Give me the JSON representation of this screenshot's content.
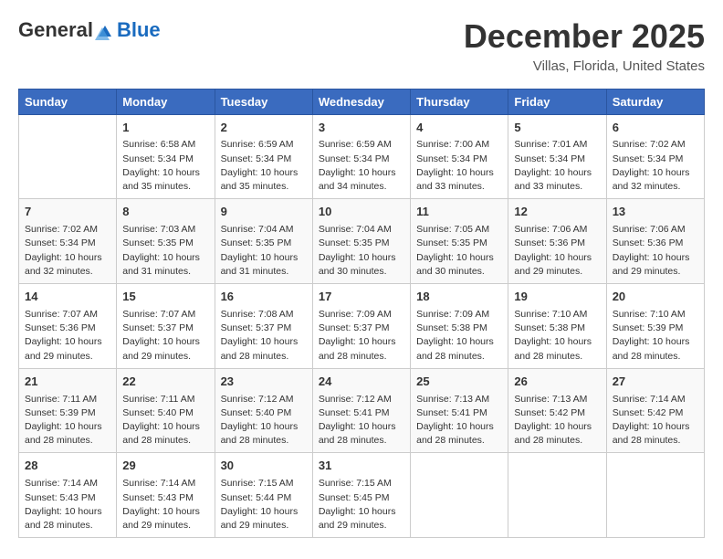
{
  "header": {
    "logo_general": "General",
    "logo_blue": "Blue",
    "month": "December 2025",
    "location": "Villas, Florida, United States"
  },
  "days_of_week": [
    "Sunday",
    "Monday",
    "Tuesday",
    "Wednesday",
    "Thursday",
    "Friday",
    "Saturday"
  ],
  "weeks": [
    [
      {
        "day": "",
        "info": ""
      },
      {
        "day": "1",
        "info": "Sunrise: 6:58 AM\nSunset: 5:34 PM\nDaylight: 10 hours\nand 35 minutes."
      },
      {
        "day": "2",
        "info": "Sunrise: 6:59 AM\nSunset: 5:34 PM\nDaylight: 10 hours\nand 35 minutes."
      },
      {
        "day": "3",
        "info": "Sunrise: 6:59 AM\nSunset: 5:34 PM\nDaylight: 10 hours\nand 34 minutes."
      },
      {
        "day": "4",
        "info": "Sunrise: 7:00 AM\nSunset: 5:34 PM\nDaylight: 10 hours\nand 33 minutes."
      },
      {
        "day": "5",
        "info": "Sunrise: 7:01 AM\nSunset: 5:34 PM\nDaylight: 10 hours\nand 33 minutes."
      },
      {
        "day": "6",
        "info": "Sunrise: 7:02 AM\nSunset: 5:34 PM\nDaylight: 10 hours\nand 32 minutes."
      }
    ],
    [
      {
        "day": "7",
        "info": "Sunrise: 7:02 AM\nSunset: 5:34 PM\nDaylight: 10 hours\nand 32 minutes."
      },
      {
        "day": "8",
        "info": "Sunrise: 7:03 AM\nSunset: 5:35 PM\nDaylight: 10 hours\nand 31 minutes."
      },
      {
        "day": "9",
        "info": "Sunrise: 7:04 AM\nSunset: 5:35 PM\nDaylight: 10 hours\nand 31 minutes."
      },
      {
        "day": "10",
        "info": "Sunrise: 7:04 AM\nSunset: 5:35 PM\nDaylight: 10 hours\nand 30 minutes."
      },
      {
        "day": "11",
        "info": "Sunrise: 7:05 AM\nSunset: 5:35 PM\nDaylight: 10 hours\nand 30 minutes."
      },
      {
        "day": "12",
        "info": "Sunrise: 7:06 AM\nSunset: 5:36 PM\nDaylight: 10 hours\nand 29 minutes."
      },
      {
        "day": "13",
        "info": "Sunrise: 7:06 AM\nSunset: 5:36 PM\nDaylight: 10 hours\nand 29 minutes."
      }
    ],
    [
      {
        "day": "14",
        "info": "Sunrise: 7:07 AM\nSunset: 5:36 PM\nDaylight: 10 hours\nand 29 minutes."
      },
      {
        "day": "15",
        "info": "Sunrise: 7:07 AM\nSunset: 5:37 PM\nDaylight: 10 hours\nand 29 minutes."
      },
      {
        "day": "16",
        "info": "Sunrise: 7:08 AM\nSunset: 5:37 PM\nDaylight: 10 hours\nand 28 minutes."
      },
      {
        "day": "17",
        "info": "Sunrise: 7:09 AM\nSunset: 5:37 PM\nDaylight: 10 hours\nand 28 minutes."
      },
      {
        "day": "18",
        "info": "Sunrise: 7:09 AM\nSunset: 5:38 PM\nDaylight: 10 hours\nand 28 minutes."
      },
      {
        "day": "19",
        "info": "Sunrise: 7:10 AM\nSunset: 5:38 PM\nDaylight: 10 hours\nand 28 minutes."
      },
      {
        "day": "20",
        "info": "Sunrise: 7:10 AM\nSunset: 5:39 PM\nDaylight: 10 hours\nand 28 minutes."
      }
    ],
    [
      {
        "day": "21",
        "info": "Sunrise: 7:11 AM\nSunset: 5:39 PM\nDaylight: 10 hours\nand 28 minutes."
      },
      {
        "day": "22",
        "info": "Sunrise: 7:11 AM\nSunset: 5:40 PM\nDaylight: 10 hours\nand 28 minutes."
      },
      {
        "day": "23",
        "info": "Sunrise: 7:12 AM\nSunset: 5:40 PM\nDaylight: 10 hours\nand 28 minutes."
      },
      {
        "day": "24",
        "info": "Sunrise: 7:12 AM\nSunset: 5:41 PM\nDaylight: 10 hours\nand 28 minutes."
      },
      {
        "day": "25",
        "info": "Sunrise: 7:13 AM\nSunset: 5:41 PM\nDaylight: 10 hours\nand 28 minutes."
      },
      {
        "day": "26",
        "info": "Sunrise: 7:13 AM\nSunset: 5:42 PM\nDaylight: 10 hours\nand 28 minutes."
      },
      {
        "day": "27",
        "info": "Sunrise: 7:14 AM\nSunset: 5:42 PM\nDaylight: 10 hours\nand 28 minutes."
      }
    ],
    [
      {
        "day": "28",
        "info": "Sunrise: 7:14 AM\nSunset: 5:43 PM\nDaylight: 10 hours\nand 28 minutes."
      },
      {
        "day": "29",
        "info": "Sunrise: 7:14 AM\nSunset: 5:43 PM\nDaylight: 10 hours\nand 29 minutes."
      },
      {
        "day": "30",
        "info": "Sunrise: 7:15 AM\nSunset: 5:44 PM\nDaylight: 10 hours\nand 29 minutes."
      },
      {
        "day": "31",
        "info": "Sunrise: 7:15 AM\nSunset: 5:45 PM\nDaylight: 10 hours\nand 29 minutes."
      },
      {
        "day": "",
        "info": ""
      },
      {
        "day": "",
        "info": ""
      },
      {
        "day": "",
        "info": ""
      }
    ]
  ]
}
